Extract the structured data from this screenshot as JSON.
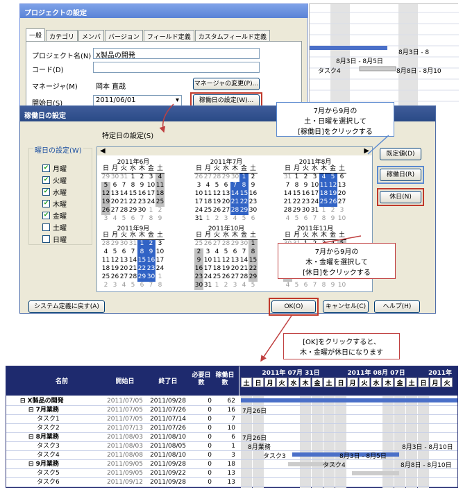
{
  "dlg1": {
    "title": "プロジェクトの設定",
    "tabs": [
      "一般",
      "カテゴリ",
      "メンバ",
      "バージョン",
      "フィールド定義",
      "カスタムフィールド定義"
    ],
    "name_label": "プロジェクト名(N)",
    "name_value": "X製品の開発",
    "code_label": "コード(D)",
    "manager_label": "マネージャ(M)",
    "manager_value": "岡本 直哉",
    "manager_btn": "マネージャの変更(P)...",
    "start_label": "開始日(S)",
    "start_value": "2011/06/01",
    "workday_btn": "稼働日の設定(W)..."
  },
  "gtop": {
    "label1": "8月3日 - 8",
    "label2": "8月3日 - 8月5日",
    "task": "タスク4",
    "label3": "8月8日 - 8月10"
  },
  "dlg2": {
    "title": "稼働日の設定",
    "special_label": "特定日の設定(S)",
    "weekday_group": "曜日の設定(W)",
    "weekdays": [
      {
        "label": "月曜",
        "checked": true
      },
      {
        "label": "火曜",
        "checked": true
      },
      {
        "label": "水曜",
        "checked": true
      },
      {
        "label": "木曜",
        "checked": true
      },
      {
        "label": "金曜",
        "checked": true
      },
      {
        "label": "土曜",
        "checked": false
      },
      {
        "label": "日曜",
        "checked": false
      }
    ],
    "dow": [
      "日",
      "月",
      "火",
      "水",
      "木",
      "金",
      "土"
    ],
    "default_btn": "既定値(D)",
    "workday_btn": "稼働日(R)",
    "holiday_btn": "休日(N)",
    "reset_btn": "システム定義に戻す(A)",
    "ok_btn": "OK(O)",
    "cancel_btn": "キャンセル(C)",
    "help_btn": "ヘルプ(H)",
    "months": [
      "2011年6月",
      "2011年7月",
      "2011年8月",
      "2011年9月",
      "2011年10月",
      "2011年11月"
    ]
  },
  "callout1": [
    "7月から9月の",
    "土・日曜を選択して",
    "[稼働日]をクリックする"
  ],
  "callout2": [
    "7月から9月の",
    "木・金曜を選択して",
    "[休日]をクリックする"
  ],
  "callout3": [
    "[OK]をクリックすると、",
    "木・金曜が休日になります"
  ],
  "gantt": {
    "headers": [
      "名前",
      "開始日",
      "終了日",
      "必要日数",
      "稼働日数"
    ],
    "weeks": [
      "2011年 07月 31日",
      "2011年 08月 07日",
      "2011年"
    ],
    "days": [
      "土",
      "日",
      "月",
      "火",
      "水",
      "木",
      "金",
      "土",
      "日",
      "月",
      "火",
      "水",
      "木",
      "金",
      "土",
      "日",
      "月",
      "火"
    ],
    "rows": [
      {
        "name": "X製品の開発",
        "start": "2011/07/05",
        "end": "2011/09/28",
        "need": "0",
        "work": "62",
        "indent": 0,
        "icon": "folder"
      },
      {
        "name": "7月業務",
        "start": "2011/07/05",
        "end": "2011/07/26",
        "need": "0",
        "work": "16",
        "indent": 1,
        "icon": "box"
      },
      {
        "name": "タスク1",
        "start": "2011/07/05",
        "end": "2011/07/14",
        "need": "0",
        "work": "7",
        "indent": 2,
        "icon": "doc"
      },
      {
        "name": "タスク2",
        "start": "2011/07/13",
        "end": "2011/07/26",
        "need": "0",
        "work": "10",
        "indent": 2,
        "icon": "doc"
      },
      {
        "name": "8月業務",
        "start": "2011/08/03",
        "end": "2011/08/10",
        "need": "0",
        "work": "6",
        "indent": 1,
        "icon": "box"
      },
      {
        "name": "タスク3",
        "start": "2011/08/03",
        "end": "2011/08/05",
        "need": "0",
        "work": "1",
        "indent": 2,
        "icon": "doc"
      },
      {
        "name": "タスク4",
        "start": "2011/08/08",
        "end": "2011/08/10",
        "need": "0",
        "work": "3",
        "indent": 2,
        "icon": "doc"
      },
      {
        "name": "9月業務",
        "start": "2011/09/05",
        "end": "2011/09/28",
        "need": "0",
        "work": "18",
        "indent": 1,
        "icon": "box"
      },
      {
        "name": "タスク5",
        "start": "2011/09/05",
        "end": "2011/09/22",
        "need": "0",
        "work": "13",
        "indent": 2,
        "icon": "doc"
      },
      {
        "name": "タスク6",
        "start": "2011/09/12",
        "end": "2011/09/28",
        "need": "0",
        "work": "13",
        "indent": 2,
        "icon": "doc"
      }
    ],
    "bar_labels": {
      "r1": "7月26日",
      "r3": "7月26日",
      "r4a": "8月業務",
      "r4b": "8月3日 - 8月10日",
      "r5a": "タスク3",
      "r5b": "8月3日 - 8月5日",
      "r6a": "タスク4",
      "r6b": "8月8日 - 8月10日"
    }
  }
}
